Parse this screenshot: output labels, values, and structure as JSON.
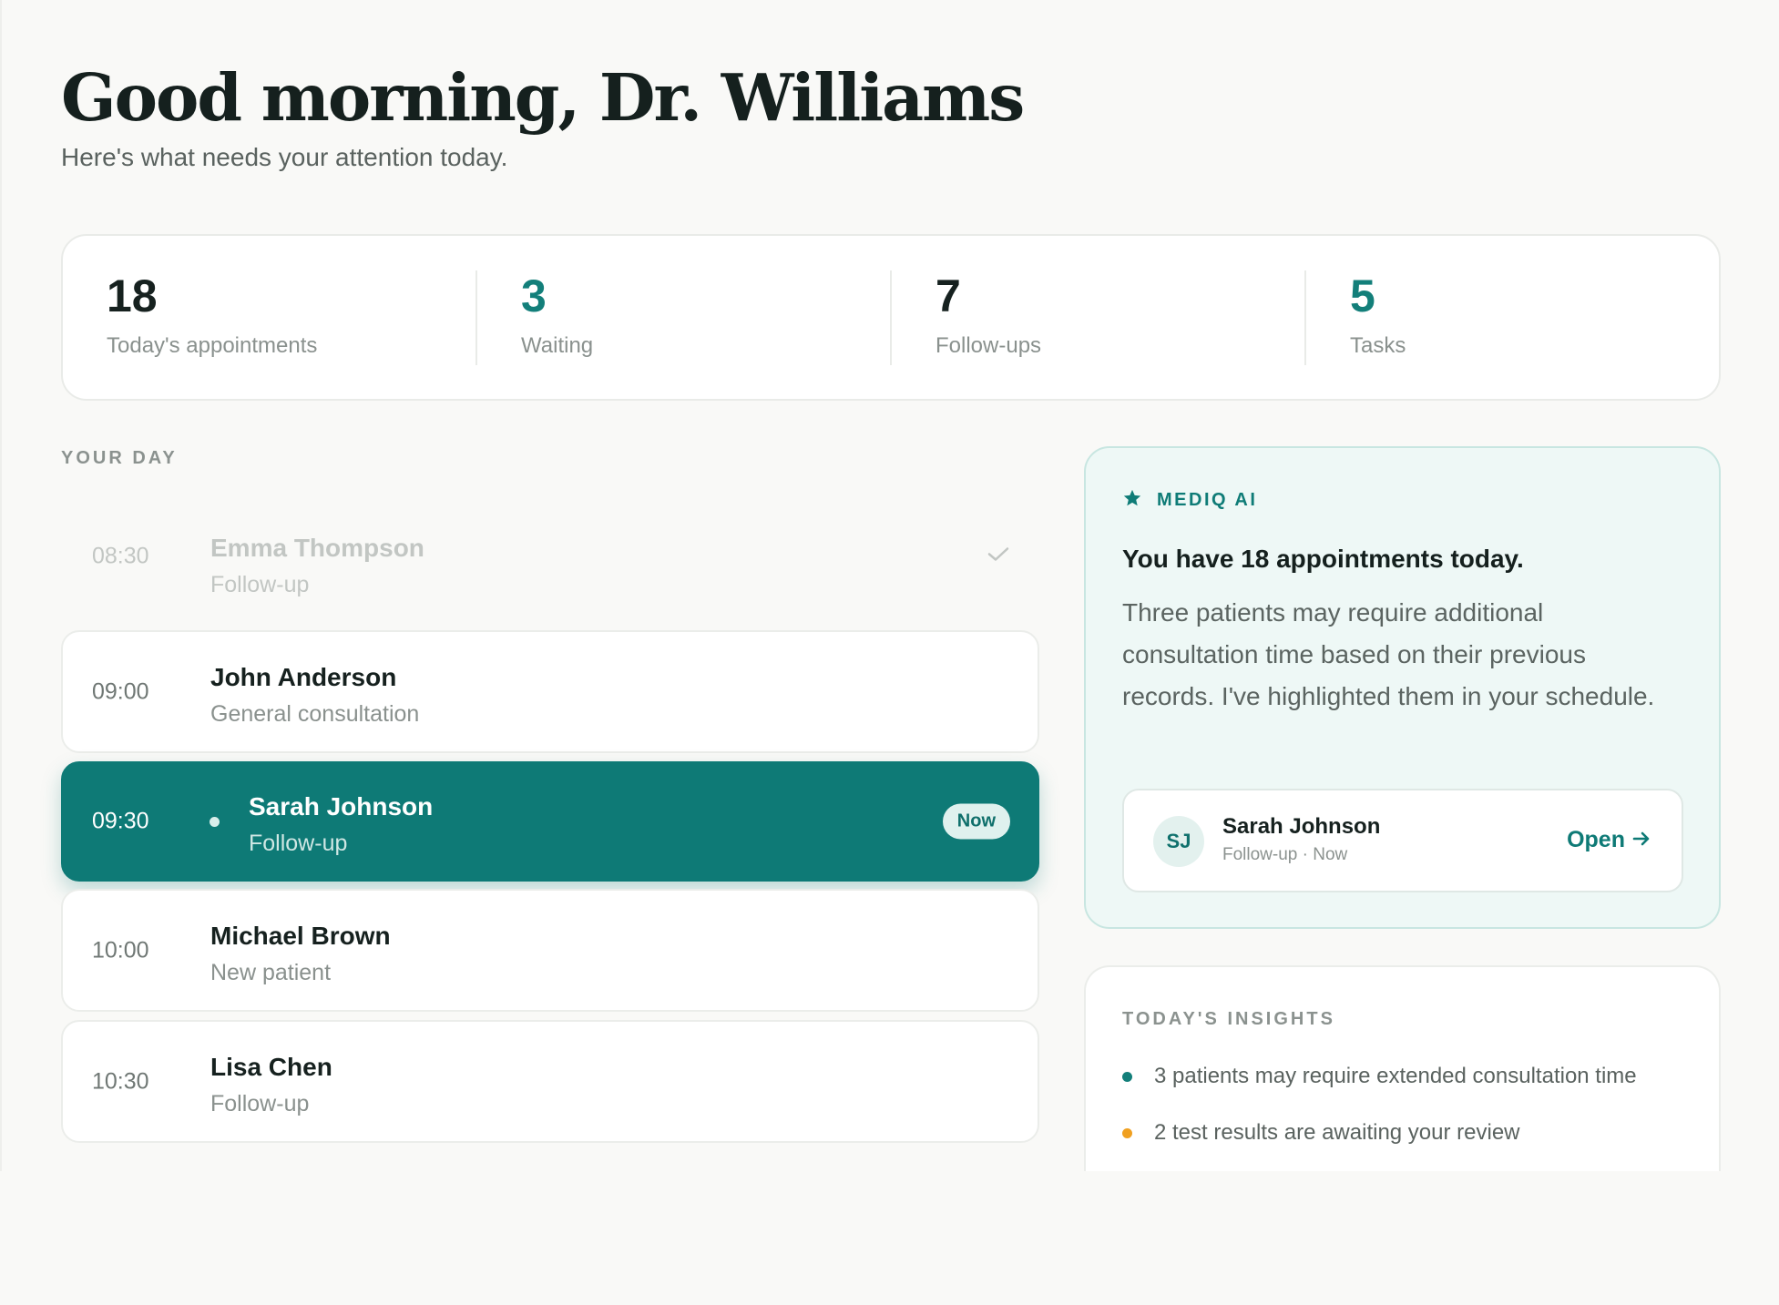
{
  "header": {
    "greeting": "Good morning, Dr. Williams",
    "subtitle": "Here's what needs your attention today."
  },
  "stats": [
    {
      "value": "18",
      "label": "Today's appointments"
    },
    {
      "value": "3",
      "label": "Waiting"
    },
    {
      "value": "7",
      "label": "Follow-ups"
    },
    {
      "value": "5",
      "label": "Tasks"
    }
  ],
  "schedule": {
    "section_label": "YOUR DAY",
    "appointments": [
      {
        "time": "08:30",
        "name": "Emma Thompson",
        "type": "Follow-up",
        "status": "done"
      },
      {
        "time": "09:00",
        "name": "John Anderson",
        "type": "General consultation",
        "status": "upcoming"
      },
      {
        "time": "09:30",
        "name": "Sarah Johnson",
        "type": "Follow-up",
        "status": "now",
        "badge": "Now"
      },
      {
        "time": "10:00",
        "name": "Michael Brown",
        "type": "New patient",
        "status": "upcoming"
      },
      {
        "time": "10:30",
        "name": "Lisa Chen",
        "type": "Follow-up",
        "status": "upcoming"
      }
    ]
  },
  "ai": {
    "label": "MEDIQ AI",
    "title": "You have 18 appointments today.",
    "body": "Three patients may require additional consultation time based on their previous records. I've highlighted them in your schedule.",
    "patient": {
      "initials": "SJ",
      "name": "Sarah Johnson",
      "sub": "Follow-up · Now",
      "action": "Open"
    }
  },
  "insights": {
    "label": "TODAY'S INSIGHTS",
    "items": [
      {
        "text": "3 patients may require extended consultation time",
        "color": "#137f7a"
      },
      {
        "text": "2 test results are awaiting your review",
        "color": "#f0a020"
      }
    ]
  },
  "colors": {
    "accent": "#0e7a76",
    "background": "#f9f9f7",
    "warning": "#f0a020"
  }
}
